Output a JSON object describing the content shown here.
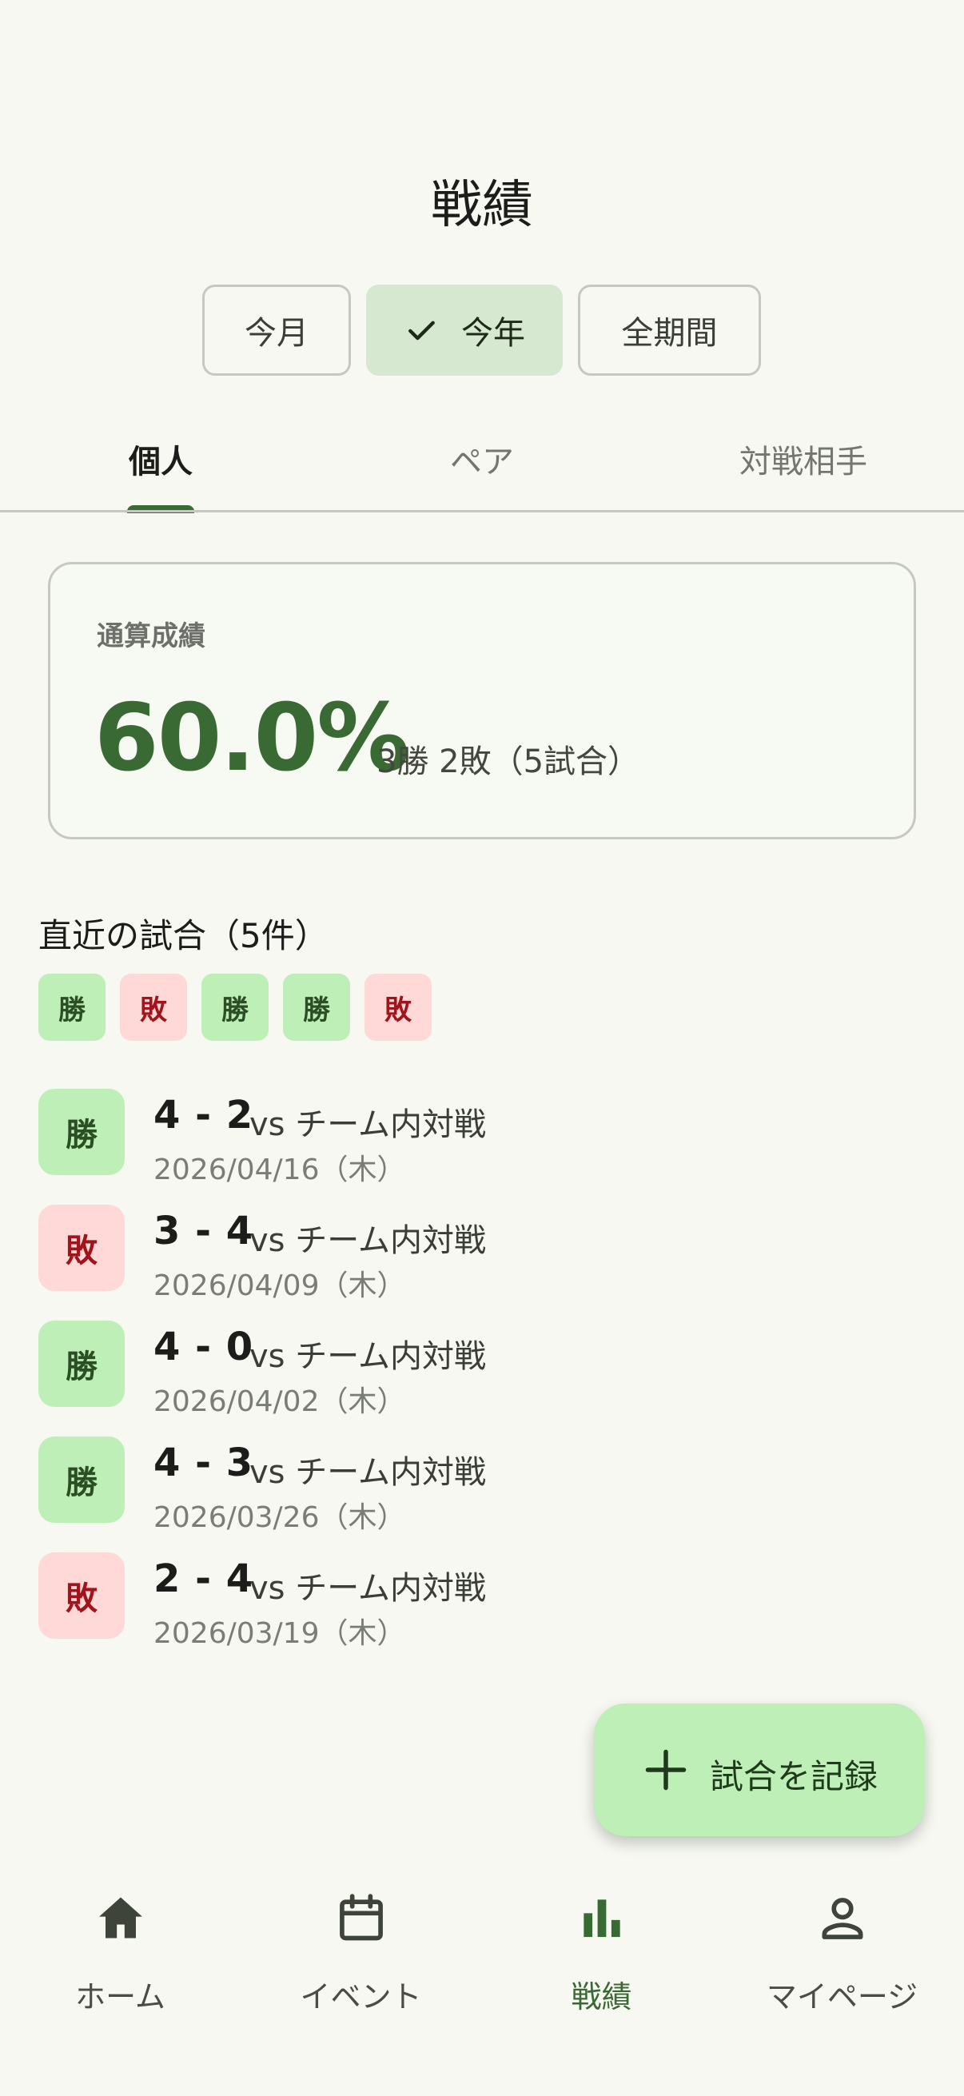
{
  "header": {
    "title": "戦績"
  },
  "filters": [
    {
      "label": "今月",
      "selected": false
    },
    {
      "label": "今年",
      "selected": true
    },
    {
      "label": "全期間",
      "selected": false
    }
  ],
  "tabs": [
    {
      "label": "個人",
      "active": true
    },
    {
      "label": "ペア",
      "active": false
    },
    {
      "label": "対戦相手",
      "active": false
    }
  ],
  "summary": {
    "label": "通算成績",
    "win_rate": "60.0%",
    "detail": "3勝 2敗（5試合）"
  },
  "recent": {
    "title": "直近の試合（5件）",
    "form": [
      {
        "label": "勝",
        "result": "win"
      },
      {
        "label": "敗",
        "result": "loss"
      },
      {
        "label": "勝",
        "result": "win"
      },
      {
        "label": "勝",
        "result": "win"
      },
      {
        "label": "敗",
        "result": "loss"
      }
    ]
  },
  "matches": [
    {
      "result_label": "勝",
      "result": "win",
      "score": "4 - 2",
      "opponent": "vs チーム内対戦",
      "date": "2026/04/16（木）"
    },
    {
      "result_label": "敗",
      "result": "loss",
      "score": "3 - 4",
      "opponent": "vs チーム内対戦",
      "date": "2026/04/09（木）"
    },
    {
      "result_label": "勝",
      "result": "win",
      "score": "4 - 0",
      "opponent": "vs チーム内対戦",
      "date": "2026/04/02（木）"
    },
    {
      "result_label": "勝",
      "result": "win",
      "score": "4 - 3",
      "opponent": "vs チーム内対戦",
      "date": "2026/03/26（木）"
    },
    {
      "result_label": "敗",
      "result": "loss",
      "score": "2 - 4",
      "opponent": "vs チーム内対戦",
      "date": "2026/03/19（木）"
    }
  ],
  "fab": {
    "label": "試合を記録",
    "icon": "plus-icon"
  },
  "nav": [
    {
      "label": "ホーム",
      "icon": "home-icon",
      "active": false
    },
    {
      "label": "イベント",
      "icon": "calendar-icon",
      "active": false
    },
    {
      "label": "戦績",
      "icon": "bar-chart-icon",
      "active": true
    },
    {
      "label": "マイページ",
      "icon": "person-icon",
      "active": false
    }
  ],
  "colors": {
    "primary": "#3a6a33",
    "win_bg": "#bdefb7",
    "win_text": "#2b4e25",
    "loss_bg": "#ffd9d7",
    "loss_text": "#a1141b",
    "selected_chip": "#d6e8cf",
    "background": "#f6f8f1"
  }
}
